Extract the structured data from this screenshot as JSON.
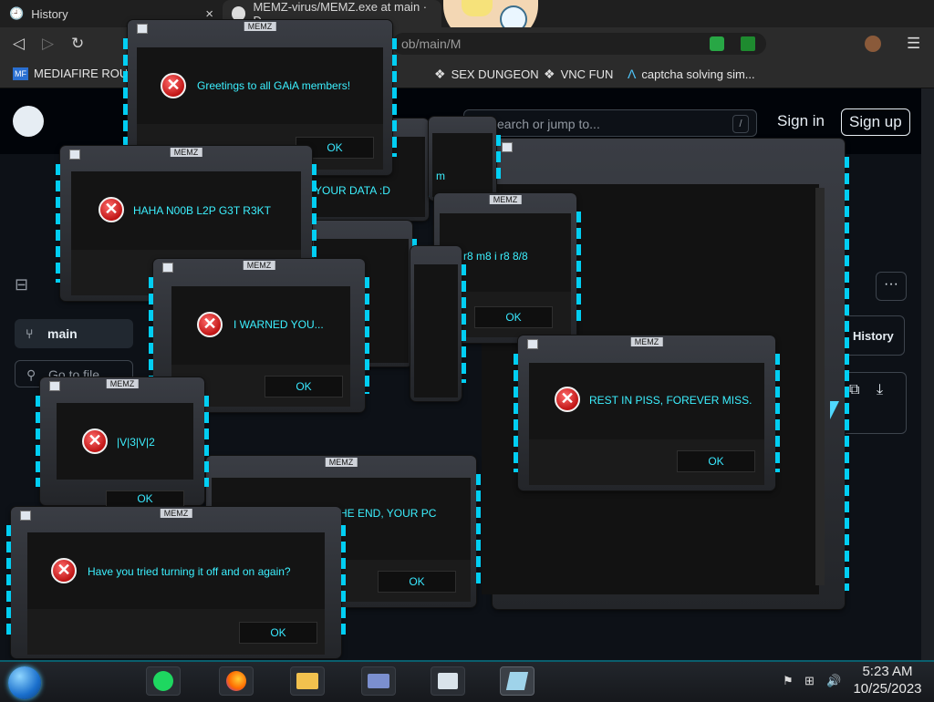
{
  "browser": {
    "tabs": [
      {
        "label": "History",
        "close": "×"
      },
      {
        "label": "MEMZ-virus/MEMZ.exe at main · D",
        "close": "×"
      }
    ],
    "url_fragment": "ob/main/M",
    "bookmarks": [
      {
        "label": "MEDIAFIRE ROUL",
        "icon": "mediafire-icon"
      },
      {
        "label": "SEX DUNGEON",
        "icon": "puzzle-icon"
      },
      {
        "label": "VNC FUN",
        "icon": "puzzle-icon"
      },
      {
        "label": "captcha solving sim...",
        "icon": "a-icon"
      }
    ]
  },
  "github": {
    "search_placeholder": "earch or jump to...",
    "slash": "/",
    "sign_in": "Sign in",
    "sign_up": "Sign up",
    "branch": "main",
    "go_to_file": "Go to file",
    "history": "History",
    "more": "···"
  },
  "memz": {
    "title": "MEMZ",
    "ok": "OK",
    "messages": {
      "gaia": "Greetings to all GAiA members!",
      "haha": "HAHA N00B L2P G3T R3KT",
      "data": "YOUR DATA :D",
      "r8": "r8 m8 i r8 8/8",
      "warned": "I WARNED YOU...",
      "rip": "REST IN PISS, FOREVER MISS.",
      "meme": "|V|3|V|2",
      "end": "HE END, YOUR PC",
      "tried": "Have you tried turning it off and on again?",
      "m": "m"
    }
  },
  "taskbar": {
    "time": "5:23 AM",
    "date": "10/25/2023"
  }
}
